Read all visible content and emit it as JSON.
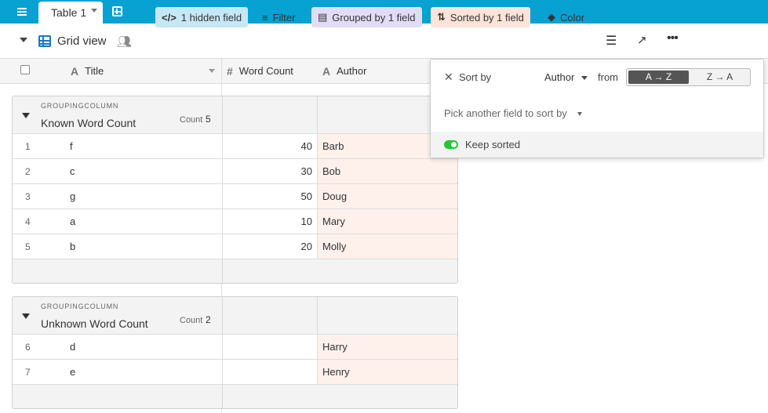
{
  "tabs": [
    {
      "label": "Table 1"
    }
  ],
  "view": {
    "name": "Grid view"
  },
  "toolbar": {
    "hidden_fields": "1 hidden field",
    "filter": "Filter",
    "grouped": "Grouped by 1 field",
    "sorted": "Sorted by 1 field",
    "color": "Color"
  },
  "columns": {
    "title": "Title",
    "word_count": "Word Count",
    "author": "Author"
  },
  "groups": [
    {
      "column_label": "GROUPINGCOLUMN",
      "name": "Known Word Count",
      "count_label": "Count",
      "count": "5",
      "rows": [
        {
          "num": "1",
          "title": "f",
          "word_count": "40",
          "author": "Barb"
        },
        {
          "num": "2",
          "title": "c",
          "word_count": "30",
          "author": "Bob"
        },
        {
          "num": "3",
          "title": "g",
          "word_count": "50",
          "author": "Doug"
        },
        {
          "num": "4",
          "title": "a",
          "word_count": "10",
          "author": "Mary"
        },
        {
          "num": "5",
          "title": "b",
          "word_count": "20",
          "author": "Molly"
        }
      ]
    },
    {
      "column_label": "GROUPINGCOLUMN",
      "name": "Unknown Word Count",
      "count_label": "Count",
      "count": "2",
      "rows": [
        {
          "num": "6",
          "title": "d",
          "word_count": "",
          "author": "Harry"
        },
        {
          "num": "7",
          "title": "e",
          "word_count": "",
          "author": "Henry"
        }
      ]
    }
  ],
  "sort_popover": {
    "sort_by_label": "Sort by",
    "field": "Author",
    "from_label": "from",
    "asc_label": "A → Z",
    "desc_label": "Z → A",
    "selected_direction": "A → Z",
    "pick_another": "Pick another field to sort by",
    "keep_sorted_label": "Keep sorted",
    "keep_sorted": true
  },
  "colors": {
    "topbar": "#07a1d2",
    "hidden_fields_bg": "#c6e7f5",
    "grouped_bg": "#e3dcf7",
    "sorted_bg": "#fde3d8",
    "author_cell_bg": "#fef1ec",
    "toggle_on": "#20c933"
  },
  "icons": [
    "menu-icon",
    "add-table-icon",
    "grid-view-icon",
    "people-icon",
    "hide-fields-icon",
    "filter-icon",
    "group-icon",
    "sort-icon",
    "color-bucket-icon",
    "row-height-icon",
    "share-icon",
    "more-icon"
  ]
}
